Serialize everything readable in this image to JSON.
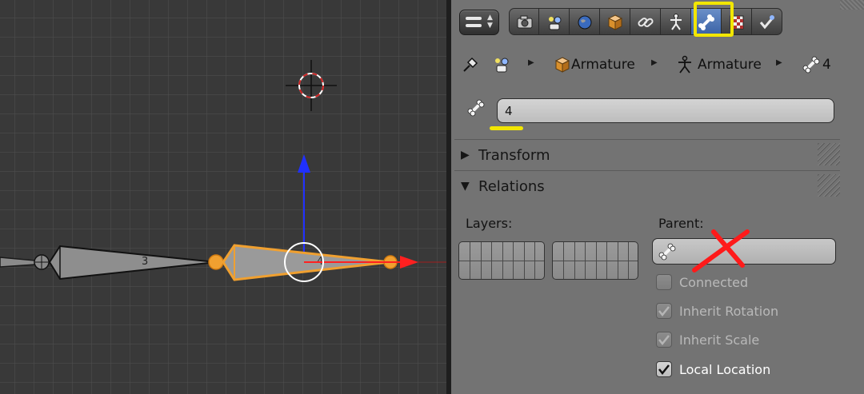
{
  "viewport": {
    "bone_labels": [
      "3",
      "4"
    ],
    "colors": {
      "background": "#393939",
      "selected_bone": "#f0a030",
      "x_axis": "#ff2020",
      "z_axis": "#2030ff",
      "cursor_ring": "#e02020"
    }
  },
  "properties": {
    "editor_type_icon": "properties-editor-icon",
    "context_tabs": [
      {
        "icon": "render-icon",
        "active": false
      },
      {
        "icon": "render-layers-icon",
        "active": false
      },
      {
        "icon": "world-icon",
        "active": false
      },
      {
        "icon": "object-icon",
        "active": false
      },
      {
        "icon": "constraints-icon",
        "active": false
      },
      {
        "icon": "armature-data-icon",
        "active": false
      },
      {
        "icon": "bone-icon",
        "active": true
      },
      {
        "icon": "material-checker-icon",
        "active": false
      },
      {
        "icon": "bone-constraint-icon",
        "active": false
      }
    ],
    "breadcrumb": {
      "items": [
        {
          "icon": "scene-icon",
          "label": ""
        },
        {
          "icon": "object-cube-icon",
          "label": "Armature"
        },
        {
          "icon": "armature-icon",
          "label": "Armature"
        },
        {
          "icon": "bone-icon",
          "label": "4"
        }
      ]
    },
    "bone_name": {
      "value": "4"
    },
    "sections": [
      {
        "title": "Transform",
        "expanded": false
      },
      {
        "title": "Relations",
        "expanded": true
      }
    ],
    "relations": {
      "layers_label": "Layers:",
      "parent_label": "Parent:",
      "parent_value": "",
      "checkboxes": [
        {
          "label": "Connected",
          "checked": false,
          "enabled": false
        },
        {
          "label": "Inherit Rotation",
          "checked": true,
          "enabled": false
        },
        {
          "label": "Inherit Scale",
          "checked": true,
          "enabled": false
        },
        {
          "label": "Local Location",
          "checked": true,
          "enabled": true
        }
      ]
    },
    "annotation_colors": {
      "highlight": "#f2e600",
      "cross": "#ff1a1a"
    }
  }
}
